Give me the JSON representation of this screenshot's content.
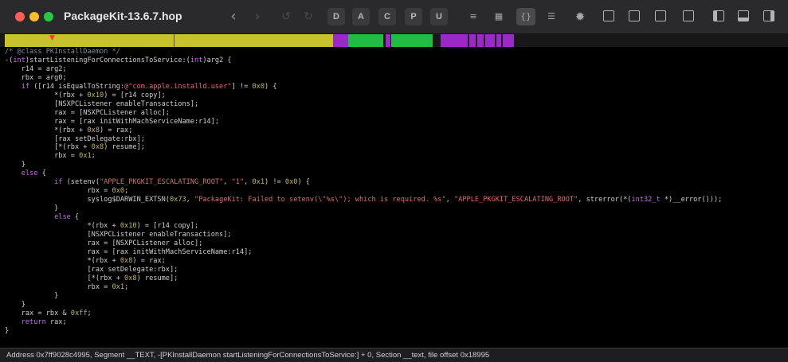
{
  "window": {
    "title": "PackageKit-13.6.7.hop"
  },
  "mode_buttons": [
    "D",
    "A",
    "C",
    "P",
    "U"
  ],
  "colors": {
    "yellow": "#c8c32a",
    "green": "#22bb44",
    "purple": "#9a29c8"
  },
  "code": {
    "lines": [
      [
        {
          "t": "/* @class PKInstallDaemon */",
          "c": "c"
        }
      ],
      [
        {
          "t": "-("
        },
        {
          "t": "int",
          "c": "k"
        },
        {
          "t": ")startListeningForConnectionsToService:("
        },
        {
          "t": "int",
          "c": "k"
        },
        {
          "t": ")arg2 {"
        }
      ],
      [
        {
          "t": "    r14 = arg2;"
        }
      ],
      [
        {
          "t": "    rbx = arg0;"
        }
      ],
      [
        {
          "t": "    "
        },
        {
          "t": "if",
          "c": "k"
        },
        {
          "t": " ([r14 isEqualToString:"
        },
        {
          "t": "@\"com.apple.installd.user\"",
          "c": "s"
        },
        {
          "t": "] != "
        },
        {
          "t": "0x0",
          "c": "n"
        },
        {
          "t": ") {"
        }
      ],
      [
        {
          "t": "            *(rbx + "
        },
        {
          "t": "0x10",
          "c": "n"
        },
        {
          "t": ") = [r14 copy];"
        }
      ],
      [
        {
          "t": "            [NSXPCListener enableTransactions];"
        }
      ],
      [
        {
          "t": "            rax = [NSXPCListener alloc];"
        }
      ],
      [
        {
          "t": "            rax = [rax initWithMachServiceName:r14];"
        }
      ],
      [
        {
          "t": "            *(rbx + "
        },
        {
          "t": "0x8",
          "c": "n"
        },
        {
          "t": ") = rax;"
        }
      ],
      [
        {
          "t": "            [rax setDelegate:rbx];"
        }
      ],
      [
        {
          "t": "            [*(rbx + "
        },
        {
          "t": "0x8",
          "c": "n"
        },
        {
          "t": ") resume];"
        }
      ],
      [
        {
          "t": "            rbx = "
        },
        {
          "t": "0x1",
          "c": "n"
        },
        {
          "t": ";"
        }
      ],
      [
        {
          "t": "    }"
        }
      ],
      [
        {
          "t": "    "
        },
        {
          "t": "else",
          "c": "k"
        },
        {
          "t": " {"
        }
      ],
      [
        {
          "t": "            "
        },
        {
          "t": "if",
          "c": "k"
        },
        {
          "t": " (setenv("
        },
        {
          "t": "\"APPLE_PKGKIT_ESCALATING_ROOT\"",
          "c": "s"
        },
        {
          "t": ", "
        },
        {
          "t": "\"1\"",
          "c": "s"
        },
        {
          "t": ", "
        },
        {
          "t": "0x1",
          "c": "n"
        },
        {
          "t": ") != "
        },
        {
          "t": "0x0",
          "c": "n"
        },
        {
          "t": ") {"
        }
      ],
      [
        {
          "t": "                    rbx = "
        },
        {
          "t": "0x0",
          "c": "n"
        },
        {
          "t": ";"
        }
      ],
      [
        {
          "t": "                    syslog$DARWIN_EXTSN("
        },
        {
          "t": "0x73",
          "c": "n"
        },
        {
          "t": ", "
        },
        {
          "t": "\"PackageKit: Failed to setenv(\\\"%s\\\"); which is required. %s\"",
          "c": "s"
        },
        {
          "t": ", "
        },
        {
          "t": "\"APPLE_PKGKIT_ESCALATING_ROOT\"",
          "c": "s"
        },
        {
          "t": ", strerror(*("
        },
        {
          "t": "int32_t",
          "c": "k"
        },
        {
          "t": " *)__error()));"
        }
      ],
      [
        {
          "t": "            }"
        }
      ],
      [
        {
          "t": "            "
        },
        {
          "t": "else",
          "c": "k"
        },
        {
          "t": " {"
        }
      ],
      [
        {
          "t": "                    *(rbx + "
        },
        {
          "t": "0x10",
          "c": "n"
        },
        {
          "t": ") = [r14 copy];"
        }
      ],
      [
        {
          "t": "                    [NSXPCListener enableTransactions];"
        }
      ],
      [
        {
          "t": "                    rax = [NSXPCListener alloc];"
        }
      ],
      [
        {
          "t": "                    rax = [rax initWithMachServiceName:r14];"
        }
      ],
      [
        {
          "t": "                    *(rbx + "
        },
        {
          "t": "0x8",
          "c": "n"
        },
        {
          "t": ") = rax;"
        }
      ],
      [
        {
          "t": "                    [rax setDelegate:rbx];"
        }
      ],
      [
        {
          "t": "                    [*(rbx + "
        },
        {
          "t": "0x8",
          "c": "n"
        },
        {
          "t": ") resume];"
        }
      ],
      [
        {
          "t": "                    rbx = "
        },
        {
          "t": "0x1",
          "c": "n"
        },
        {
          "t": ";"
        }
      ],
      [
        {
          "t": "            }"
        }
      ],
      [
        {
          "t": "    }"
        }
      ],
      [
        {
          "t": "    rax = rbx & "
        },
        {
          "t": "0xff",
          "c": "n"
        },
        {
          "t": ";"
        }
      ],
      [
        {
          "t": "    "
        },
        {
          "t": "return",
          "c": "k"
        },
        {
          "t": " rax;"
        }
      ],
      [
        {
          "t": "}"
        }
      ]
    ]
  },
  "status": {
    "text": "Address 0x7ff9028c4995, Segment __TEXT, -[PKInstallDaemon startListeningForConnectionsToService:] + 0, Section __text, file offset 0x18995"
  }
}
